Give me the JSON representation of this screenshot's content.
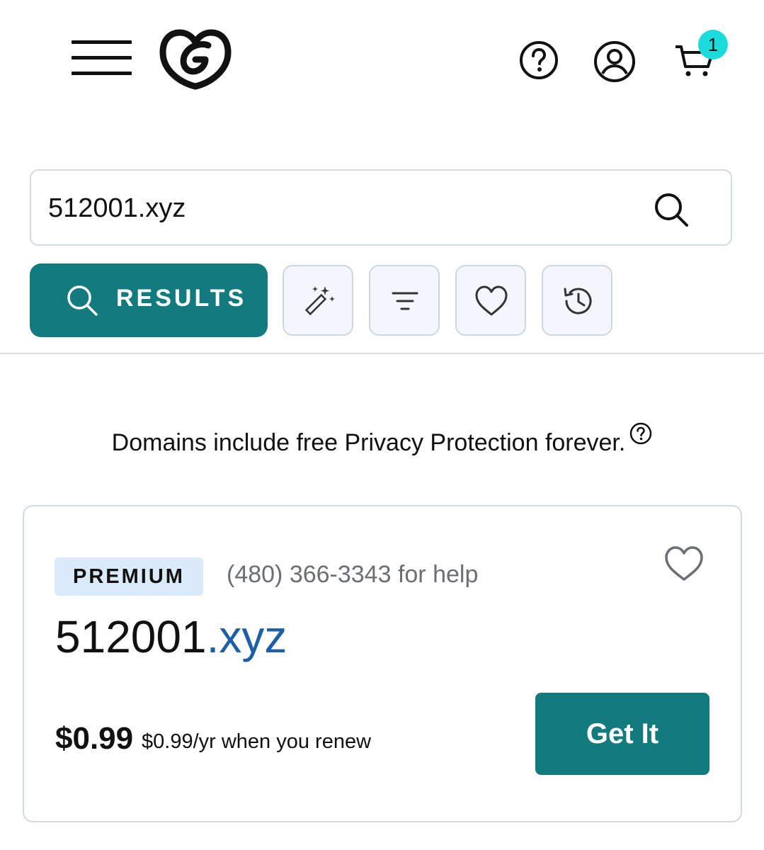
{
  "header": {
    "menu_icon": "hamburger-menu-icon",
    "logo_icon": "godaddy-g-logo",
    "help_icon": "question-circle-icon",
    "account_icon": "user-circle-icon",
    "cart_icon": "cart-icon",
    "cart_count": "1"
  },
  "search": {
    "value": "512001.xyz",
    "icon": "search-icon"
  },
  "tabs": {
    "results_label": "RESULTS",
    "tools": [
      "magic-wand-icon",
      "filter-icon",
      "heart-icon",
      "history-icon"
    ]
  },
  "notice": {
    "text": "Domains include free Privacy Protection forever.",
    "help_icon": "question-circle-icon"
  },
  "result": {
    "badge": "PREMIUM",
    "help_phone": "(480) 366-3343 for help",
    "domain_sld": "512001",
    "domain_tld": ".xyz",
    "price": "$0.99",
    "renew_text": "$0.99/yr when you renew",
    "cta_label": "Get It"
  },
  "colors": {
    "brand_teal": "#137a7d",
    "badge_cyan": "#1bdbdb",
    "premium_bg": "#dbeaf8",
    "tld_blue": "#1c5fa6"
  }
}
